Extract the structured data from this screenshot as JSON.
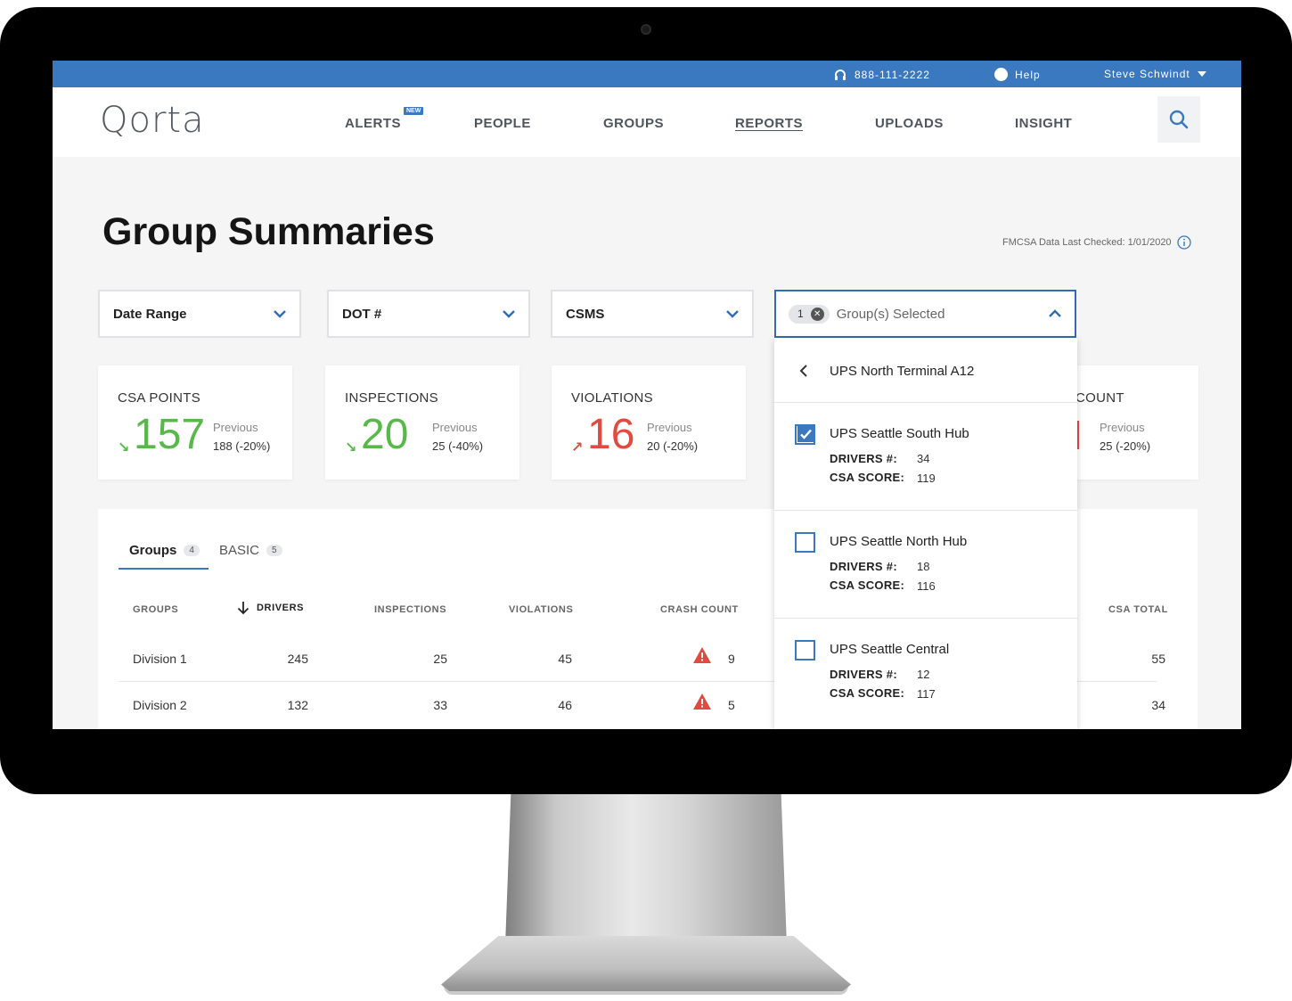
{
  "utility": {
    "phone": "888-111-2222",
    "help": "Help",
    "user": "Steve Schwindt"
  },
  "nav": {
    "logo": "Qorta",
    "new_badge": "NEW",
    "items": [
      "ALERTS",
      "PEOPLE",
      "GROUPS",
      "REPORTS",
      "UPLOADS",
      "INSIGHT"
    ],
    "active": "REPORTS"
  },
  "page": {
    "title": "Group Summaries",
    "fmcsa": "FMCSA Data Last Checked: 1/01/2020"
  },
  "filters": {
    "date_range": "Date Range",
    "dot": "DOT #",
    "csms": "CSMS",
    "group_chip_count": "1",
    "group_text": "Group(s) Selected"
  },
  "cards": [
    {
      "title": "CSA POINTS",
      "value": "157",
      "prev_label": "Previous",
      "prev": "188 (-20%)",
      "trend": "down"
    },
    {
      "title": "INSPECTIONS",
      "value": "20",
      "prev_label": "Previous",
      "prev": "25 (-40%)",
      "trend": "down"
    },
    {
      "title": "VIOLATIONS",
      "value": "16",
      "prev_label": "Previous",
      "prev": "20 (-20%)",
      "trend": "up"
    },
    {
      "title": "COUNT",
      "prev_label": "Previous",
      "prev": "25 (-20%)"
    }
  ],
  "tabs": [
    {
      "label": "Groups",
      "count": "4"
    },
    {
      "label": "BASIC",
      "count": "5"
    }
  ],
  "table": {
    "headers": [
      "GROUPS",
      "DRIVERS",
      "INSPECTIONS",
      "VIOLATIONS",
      "CRASH COUNT",
      "CSA TOTAL"
    ],
    "rows": [
      {
        "group": "Division 1",
        "drivers": "245",
        "inspections": "25",
        "violations": "45",
        "crash": "9",
        "csa_total": "55"
      },
      {
        "group": "Division 2",
        "drivers": "132",
        "inspections": "33",
        "violations": "46",
        "crash": "5",
        "csa_total": "34"
      }
    ]
  },
  "dropdown": {
    "back_label": "UPS North Terminal A12",
    "drivers_label": "DRIVERS #:",
    "csa_label": "CSA SCORE:",
    "items": [
      {
        "name": "UPS Seattle South Hub",
        "drivers": "34",
        "csa": "119",
        "checked": true
      },
      {
        "name": "UPS Seattle North Hub",
        "drivers": "18",
        "csa": "116",
        "checked": false
      },
      {
        "name": "UPS Seattle Central",
        "drivers": "12",
        "csa": "117",
        "checked": false
      }
    ]
  },
  "colors": {
    "brand_blue": "#3a78bf",
    "good_green": "#58b94a",
    "bad_red": "#e04a3f"
  }
}
